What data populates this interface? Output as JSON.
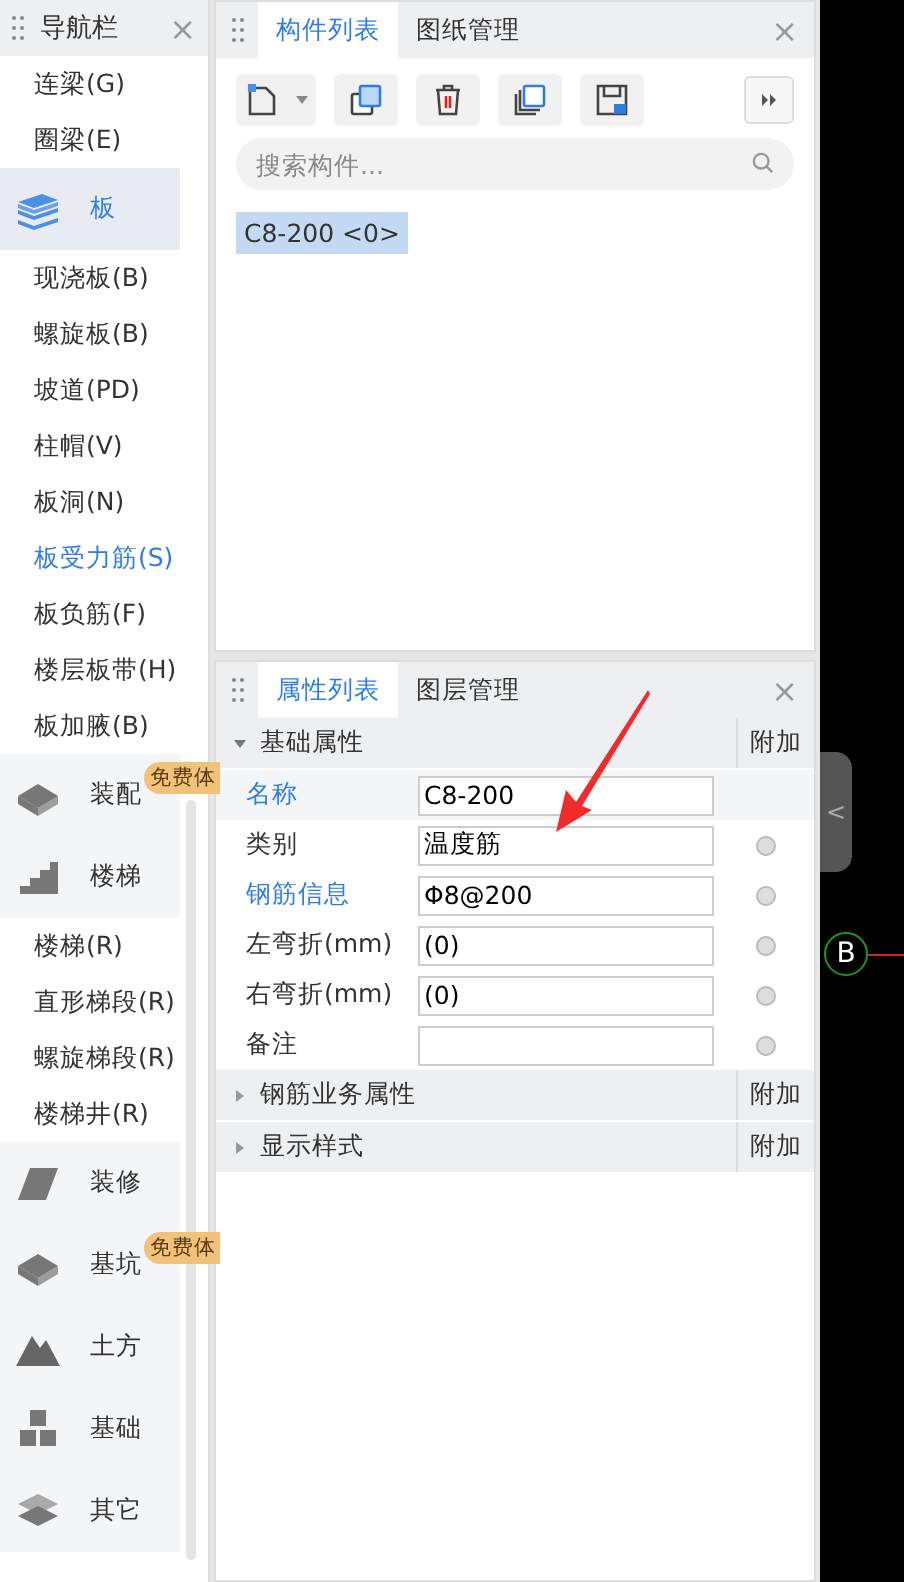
{
  "nav": {
    "title": "导航栏",
    "close": "×",
    "items": [
      {
        "kind": "item",
        "label": "连梁(G)",
        "selected": false
      },
      {
        "kind": "item",
        "label": "圈梁(E)",
        "selected": false
      },
      {
        "kind": "category",
        "label": "板",
        "selected": true,
        "children": [
          {
            "label": "现浇板(B)",
            "selected": false
          },
          {
            "label": "螺旋板(B)",
            "selected": false
          },
          {
            "label": "坡道(PD)",
            "selected": false
          },
          {
            "label": "柱帽(V)",
            "selected": false
          },
          {
            "label": "板洞(N)",
            "selected": false
          },
          {
            "label": "板受力筋(S)",
            "selected": true
          },
          {
            "label": "板负筋(F)",
            "selected": false
          },
          {
            "label": "楼层板带(H)",
            "selected": false
          },
          {
            "label": "板加腋(B)",
            "selected": false
          }
        ]
      },
      {
        "kind": "category",
        "label": "装配",
        "selected": false,
        "badge": "免费体"
      },
      {
        "kind": "category",
        "label": "楼梯",
        "selected": false,
        "children": [
          {
            "label": "楼梯(R)",
            "selected": false
          },
          {
            "label": "直形梯段(R)",
            "selected": false
          },
          {
            "label": "螺旋梯段(R)",
            "selected": false
          },
          {
            "label": "楼梯井(R)",
            "selected": false
          }
        ]
      },
      {
        "kind": "category",
        "label": "装修",
        "selected": false
      },
      {
        "kind": "category",
        "label": "基坑",
        "selected": false,
        "badge": "免费体"
      },
      {
        "kind": "category",
        "label": "土方",
        "selected": false
      },
      {
        "kind": "category",
        "label": "基础",
        "selected": false
      },
      {
        "kind": "category",
        "label": "其它",
        "selected": false
      }
    ]
  },
  "component_panel": {
    "tabs": [
      {
        "label": "构件列表",
        "selected": true
      },
      {
        "label": "图纸管理",
        "selected": false
      }
    ],
    "close": "×",
    "search": {
      "placeholder": "搜索构件..."
    },
    "components": [
      {
        "label": "C8-200 <0>",
        "selected": true
      }
    ]
  },
  "property_panel": {
    "tabs": [
      {
        "label": "属性列表",
        "selected": true
      },
      {
        "label": "图层管理",
        "selected": false
      }
    ],
    "close": "×",
    "sections": [
      {
        "label": "基础属性",
        "expanded": true,
        "column": "附加",
        "rows": [
          {
            "label": "名称",
            "public": true,
            "value": "C8-200"
          },
          {
            "label": "类别",
            "public": false,
            "value": "温度筋",
            "checked": false
          },
          {
            "label": "钢筋信息",
            "public": true,
            "value": "Φ8@200",
            "checked": false
          },
          {
            "label": "左弯折(mm)",
            "public": false,
            "value": "(0)",
            "checked": false
          },
          {
            "label": "右弯折(mm)",
            "public": false,
            "value": "(0)",
            "checked": false
          },
          {
            "label": "备注",
            "public": false,
            "value": "",
            "checked": false
          }
        ]
      },
      {
        "label": "钢筋业务属性",
        "expanded": false,
        "column": "附加"
      },
      {
        "label": "显示样式",
        "expanded": false,
        "column": "附加"
      }
    ]
  },
  "canvas": {
    "axis_label": "B",
    "collapse": "<"
  }
}
